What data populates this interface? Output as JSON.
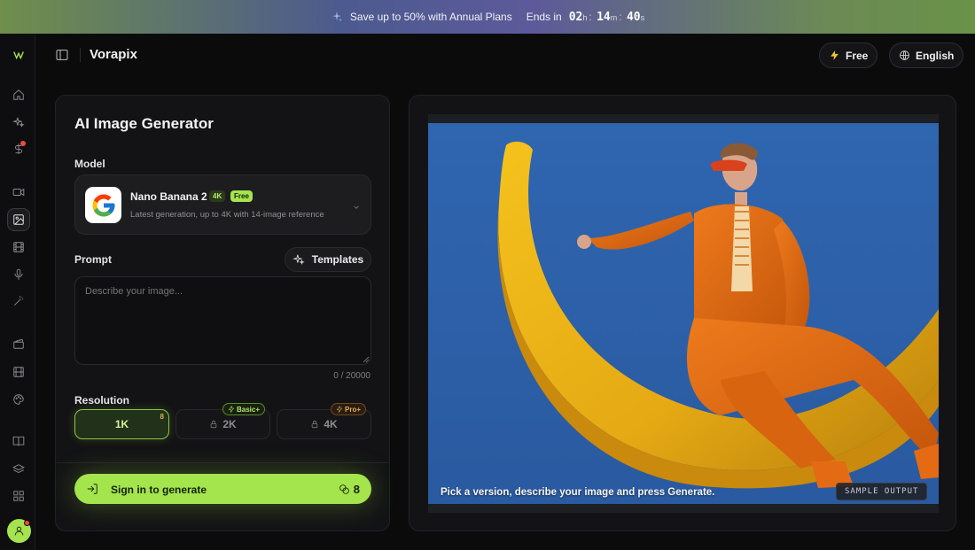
{
  "promo": {
    "message": "Save up to 50% with Annual Plans",
    "ends_label": "Ends in",
    "hours": "02",
    "hours_unit": "h",
    "minutes": "14",
    "minutes_unit": "m",
    "seconds": "40",
    "seconds_unit": "s"
  },
  "header": {
    "brand": "Vorapix",
    "plan_label": "Free",
    "language_label": "English"
  },
  "sidebar": {
    "items": [
      {
        "icon": "home-icon"
      },
      {
        "icon": "sparkles-icon"
      },
      {
        "icon": "dollar-icon",
        "notification": true
      },
      {
        "icon": "video-icon"
      },
      {
        "icon": "image-icon",
        "active": true
      },
      {
        "icon": "film-icon"
      },
      {
        "icon": "microphone-icon"
      },
      {
        "icon": "magic-wand-icon"
      },
      {
        "icon": "clapperboard-icon"
      },
      {
        "icon": "film-strip-icon"
      },
      {
        "icon": "palette-icon"
      },
      {
        "icon": "book-icon"
      },
      {
        "icon": "layers-icon"
      },
      {
        "icon": "grid-icon"
      }
    ]
  },
  "generator": {
    "title": "AI Image Generator",
    "model_label": "Model",
    "model": {
      "name": "Nano Banana 2",
      "badge_quality": "4K",
      "badge_price": "Free",
      "description": "Latest generation, up to 4K with 14-image reference"
    },
    "prompt_label": "Prompt",
    "templates_label": "Templates",
    "prompt_placeholder": "Describe your image...",
    "prompt_value": "",
    "counter": "0 / 20000",
    "resolution_label": "Resolution",
    "resolutions": [
      {
        "label": "1K",
        "credits": "8",
        "selected": true
      },
      {
        "label": "2K",
        "tier": "Basic+",
        "locked": true
      },
      {
        "label": "4K",
        "tier": "Pro+",
        "locked": true
      }
    ],
    "generate_label": "Sign in to generate",
    "generate_cost": "8"
  },
  "preview": {
    "caption": "Pick a version, describe your image and press Generate.",
    "tag": "SAMPLE OUTPUT"
  },
  "colors": {
    "accent": "#a4e44c",
    "background": "#0b0b0c",
    "panel": "#131315",
    "notification": "#f04a3c"
  }
}
